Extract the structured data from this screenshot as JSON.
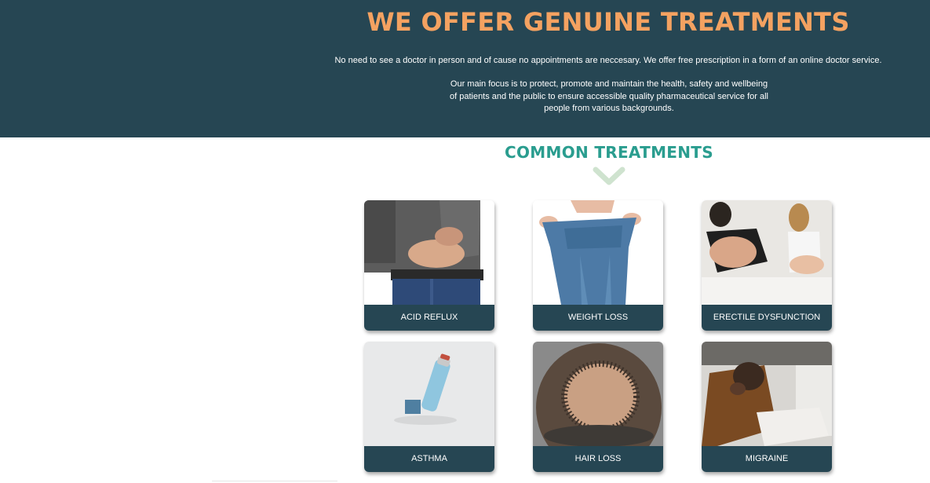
{
  "hero": {
    "title": "WE OFFER GENUINE TREATMENTS",
    "intro": "No need to see a doctor in person and of cause no appointments are neccesary. We offer free prescription in a form of an online doctor service.",
    "focus": "Our main focus is to protect, promote and maintain the health, safety and wellbeing of patients and the public to ensure accessible quality pharmaceutical service for all people from various backgrounds."
  },
  "treatments": {
    "title": "COMMON TREATMENTS",
    "scroll_icon": "chevron-down-icon",
    "items": [
      {
        "label": "ACID REFLUX"
      },
      {
        "label": "WEIGHT LOSS"
      },
      {
        "label": "ERECTILE DYSFUNCTION"
      },
      {
        "label": "ASTHMA"
      },
      {
        "label": "HAIR LOSS"
      },
      {
        "label": "MIGRAINE"
      }
    ]
  },
  "colors": {
    "header_bg": "#264653",
    "title_accent": "#f4a261",
    "section_title": "#2a9d8f",
    "chevron": "#cfe3cf",
    "card_label_bg": "#264653"
  }
}
